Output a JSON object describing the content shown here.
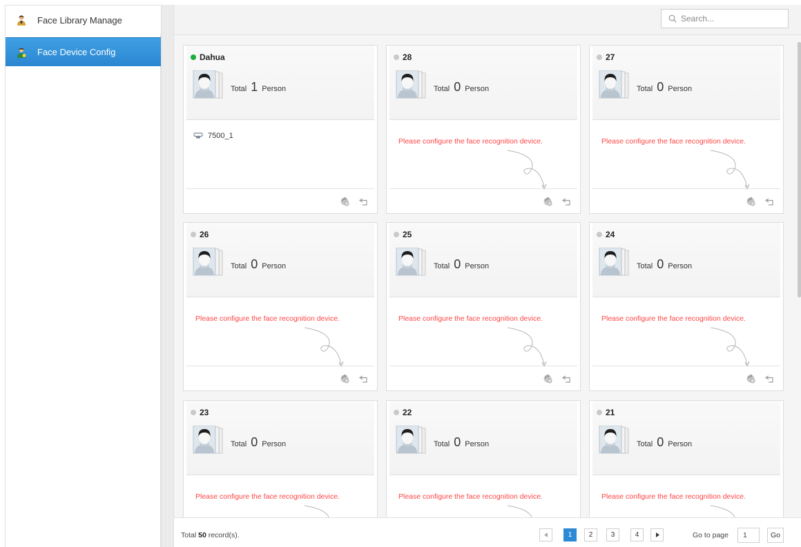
{
  "sidebar": {
    "items": [
      {
        "label": "Face Library Manage",
        "icon": "person-icon",
        "active": false
      },
      {
        "label": "Face Device Config",
        "icon": "person-gear-icon",
        "active": true
      }
    ]
  },
  "search": {
    "placeholder": "Search..."
  },
  "cards": [
    {
      "name": "Dahua",
      "status": "online",
      "total_prefix": "Total",
      "total": "1",
      "total_suffix": "Person",
      "device": "7500_1"
    },
    {
      "name": "28",
      "status": "offline",
      "total_prefix": "Total",
      "total": "0",
      "total_suffix": "Person",
      "message": "Please configure the face recognition device."
    },
    {
      "name": "27",
      "status": "offline",
      "total_prefix": "Total",
      "total": "0",
      "total_suffix": "Person",
      "message": "Please configure the face recognition device."
    },
    {
      "name": "26",
      "status": "offline",
      "total_prefix": "Total",
      "total": "0",
      "total_suffix": "Person",
      "message": "Please configure the face recognition device."
    },
    {
      "name": "25",
      "status": "offline",
      "total_prefix": "Total",
      "total": "0",
      "total_suffix": "Person",
      "message": "Please configure the face recognition device."
    },
    {
      "name": "24",
      "status": "offline",
      "total_prefix": "Total",
      "total": "0",
      "total_suffix": "Person",
      "message": "Please configure the face recognition device."
    },
    {
      "name": "23",
      "status": "offline",
      "total_prefix": "Total",
      "total": "0",
      "total_suffix": "Person",
      "message": "Please configure the face recognition device."
    },
    {
      "name": "22",
      "status": "offline",
      "total_prefix": "Total",
      "total": "0",
      "total_suffix": "Person",
      "message": "Please configure the face recognition device."
    },
    {
      "name": "21",
      "status": "offline",
      "total_prefix": "Total",
      "total": "0",
      "total_suffix": "Person",
      "message": "Please configure the face recognition device."
    }
  ],
  "footer": {
    "records_prefix": "Total",
    "records_count": "50",
    "records_suffix": "record(s).",
    "pages": [
      "1",
      "2",
      "3",
      "4"
    ],
    "current_page": "1",
    "goto_label": "Go to page",
    "goto_value": "1",
    "go_label": "Go"
  },
  "colors": {
    "accent": "#2c8ad5",
    "online": "#1aaf3a",
    "offline": "#c9c9c9",
    "warning": "#ff4444"
  }
}
